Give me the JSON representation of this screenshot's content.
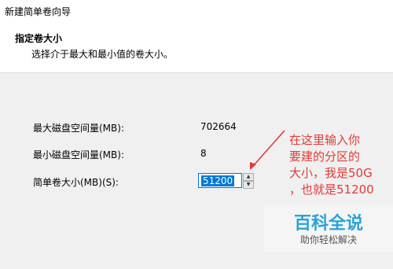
{
  "window": {
    "title": "新建简单卷向导"
  },
  "header": {
    "title": "指定卷大小",
    "subtitle": "选择介于最大和最小值的卷大小。"
  },
  "fields": {
    "max_label": "最大磁盘空间量(MB):",
    "max_value": "702664",
    "min_label": "最小磁盘空间量(MB):",
    "min_value": "8",
    "size_label": "简单卷大小(MB)(S):",
    "size_value": "51200"
  },
  "annotation": {
    "lines": [
      "在这里输入你",
      "要建的分区的",
      "大小，我是50G",
      "，也就是51200"
    ],
    "color": "#e53935"
  },
  "watermark": {
    "main": "百科全说",
    "sub": "助你轻松解决"
  },
  "colors": {
    "selection": "#0078d7",
    "window_bg": "#f0f0f0",
    "header_bg": "#ffffff"
  },
  "icons": {
    "spin_up": "spinner-up-icon",
    "spin_down": "spinner-down-icon"
  }
}
